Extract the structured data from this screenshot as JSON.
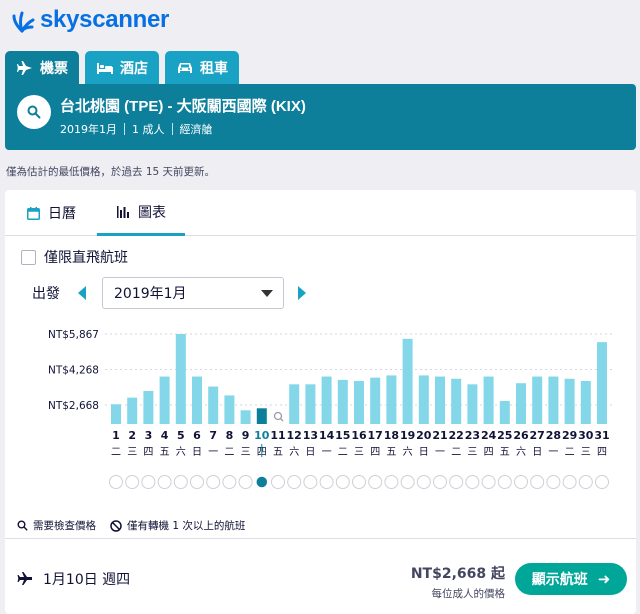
{
  "brand": {
    "name": "skyscanner"
  },
  "tabs": [
    {
      "label": "機票",
      "icon": "plane-icon",
      "active": true
    },
    {
      "label": "酒店",
      "icon": "bed-icon",
      "active": false
    },
    {
      "label": "租車",
      "icon": "car-icon",
      "active": false
    }
  ],
  "search": {
    "route": "台北桃園 (TPE) - 大阪關西國際 (KIX)",
    "month": "2019年1月",
    "travellers": "1 成人",
    "cabin": "經濟艙"
  },
  "note": "僅為估計的最低價格，於過去 15 天前更新。",
  "view_tabs": [
    {
      "label": "日曆",
      "icon": "calendar-icon",
      "active": false
    },
    {
      "label": "圖表",
      "icon": "bar-chart-icon",
      "active": true
    }
  ],
  "filters": {
    "direct_only_label": "僅限直飛航班",
    "direct_only_checked": false
  },
  "month_picker": {
    "label": "出發",
    "selected": "2019年1月"
  },
  "chart_data": {
    "type": "bar",
    "y_ticks": [
      "NT$5,867",
      "NT$4,268",
      "NT$2,668"
    ],
    "y_tick_values": [
      5867,
      4268,
      2668
    ],
    "days": [
      "1",
      "2",
      "3",
      "4",
      "5",
      "6",
      "7",
      "8",
      "9",
      "10",
      "11",
      "12",
      "13",
      "14",
      "15",
      "16",
      "17",
      "18",
      "19",
      "20",
      "21",
      "22",
      "23",
      "24",
      "25",
      "26",
      "27",
      "28",
      "29",
      "30",
      "31"
    ],
    "weekdays": [
      "二",
      "三",
      "四",
      "五",
      "六",
      "日",
      "一",
      "二",
      "三",
      "四",
      "五",
      "六",
      "日",
      "一",
      "二",
      "三",
      "四",
      "五",
      "六",
      "日",
      "一",
      "二",
      "三",
      "四",
      "五",
      "六",
      "日",
      "一",
      "二",
      "三",
      "四"
    ],
    "values": [
      2700,
      3000,
      3300,
      3950,
      5867,
      3950,
      3500,
      3100,
      2430,
      2520,
      null,
      3600,
      3600,
      3950,
      3800,
      3750,
      3900,
      4000,
      5650,
      4000,
      3950,
      3850,
      3600,
      3950,
      2850,
      3650,
      3950,
      3950,
      3850,
      3750,
      5500
    ],
    "selected_day": "10",
    "check_price_days": [
      "11"
    ],
    "colors": {
      "bar": "#84d7e8",
      "selected": "#0d7f9b",
      "grid": "#d6d6de"
    }
  },
  "legend": {
    "check_price": "需要檢查價格",
    "multi_stop": "僅有轉機 1 次以上的航班"
  },
  "selection": {
    "date": "1月10日 週四",
    "price": "NT$2,668 起",
    "price_sub": "每位成人的價格",
    "button_label": "顯示航班",
    "button_arrow": "➜"
  },
  "colors": {
    "brand": "#0770e3",
    "tab": "#1aa2c5",
    "tab_active": "#0d7f9b",
    "cta": "#00a698"
  }
}
